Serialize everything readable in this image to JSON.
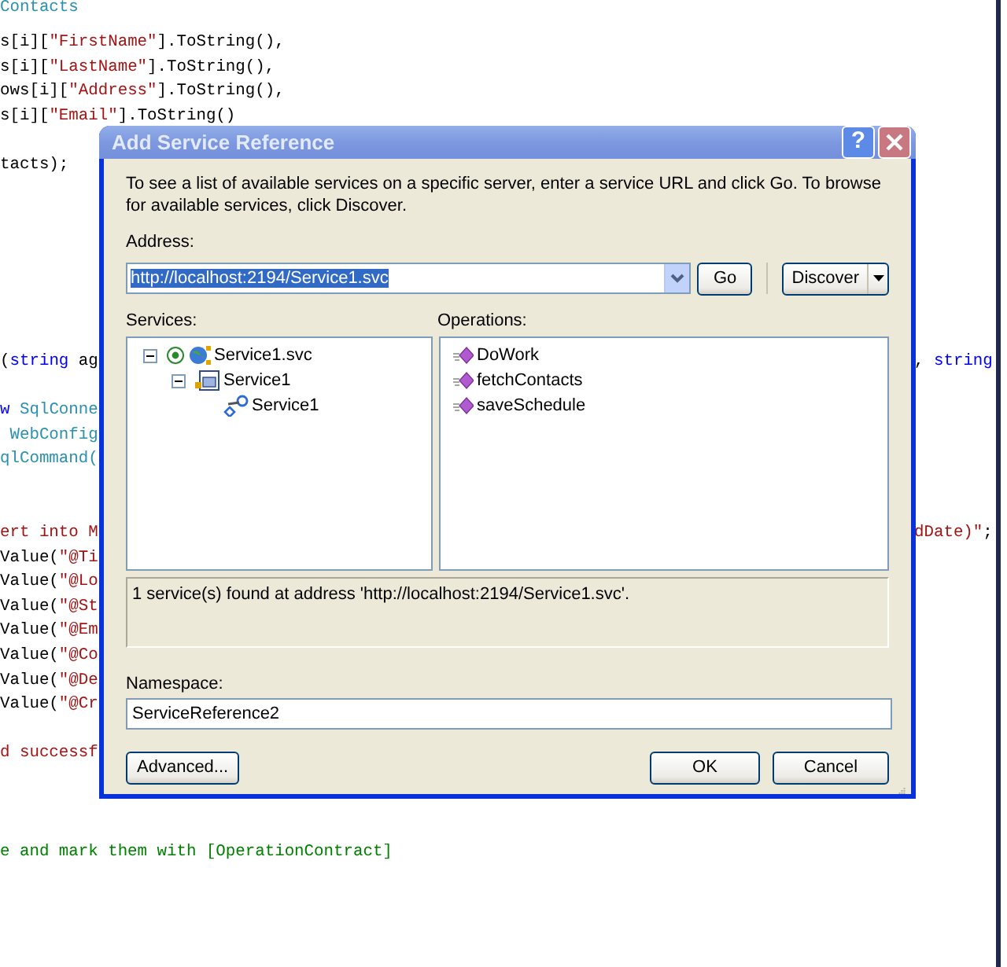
{
  "editor": {
    "code_lines": [
      {
        "left": [
          {
            "text": "Contacts",
            "kind": "type"
          }
        ]
      },
      {
        "left": [
          {
            "text": "s[i][",
            "kind": "plain"
          },
          {
            "text": "\"FirstName\"",
            "kind": "string"
          },
          {
            "text": "].ToString(),",
            "kind": "plain"
          }
        ]
      },
      {
        "left": [
          {
            "text": "s[i][",
            "kind": "plain"
          },
          {
            "text": "\"LastName\"",
            "kind": "string"
          },
          {
            "text": "].ToString(),",
            "kind": "plain"
          }
        ]
      },
      {
        "left": [
          {
            "text": "ows[i][",
            "kind": "plain"
          },
          {
            "text": "\"Address\"",
            "kind": "string"
          },
          {
            "text": "].ToString(),",
            "kind": "plain"
          }
        ]
      },
      {
        "left": [
          {
            "text": "s[i][",
            "kind": "plain"
          },
          {
            "text": "\"Email\"",
            "kind": "string"
          },
          {
            "text": "].ToString()",
            "kind": "plain"
          }
        ]
      },
      {
        "left": [
          {
            "text": "tacts);",
            "kind": "plain"
          }
        ]
      },
      {
        "left": [
          {
            "text": "(",
            "kind": "plain"
          },
          {
            "text": "string",
            "kind": "keyword"
          },
          {
            "text": " ag",
            "kind": "plain"
          }
        ],
        "right": [
          {
            "text": ", ",
            "kind": "plain"
          },
          {
            "text": "string",
            "kind": "keyword"
          }
        ]
      },
      {
        "left": [
          {
            "text": "w",
            "kind": "keyword"
          },
          {
            "text": " SqlConne",
            "kind": "type"
          }
        ]
      },
      {
        "left": [
          {
            "text": " WebConfig",
            "kind": "type"
          }
        ]
      },
      {
        "left": [
          {
            "text": "qlCommand(",
            "kind": "type"
          }
        ]
      },
      {
        "left": [
          {
            "text": "ert into M",
            "kind": "string"
          }
        ],
        "right": [
          {
            "text": "dDate)\"",
            "kind": "string"
          },
          {
            "text": ";",
            "kind": "plain"
          }
        ]
      },
      {
        "left": [
          {
            "text": "Value(",
            "kind": "plain"
          },
          {
            "text": "\"@Ti",
            "kind": "string"
          }
        ]
      },
      {
        "left": [
          {
            "text": "Value(",
            "kind": "plain"
          },
          {
            "text": "\"@Lo",
            "kind": "string"
          }
        ]
      },
      {
        "left": [
          {
            "text": "Value(",
            "kind": "plain"
          },
          {
            "text": "\"@St",
            "kind": "string"
          }
        ]
      },
      {
        "left": [
          {
            "text": "Value(",
            "kind": "plain"
          },
          {
            "text": "\"@Em",
            "kind": "string"
          }
        ]
      },
      {
        "left": [
          {
            "text": "Value(",
            "kind": "plain"
          },
          {
            "text": "\"@Co",
            "kind": "string"
          }
        ]
      },
      {
        "left": [
          {
            "text": "Value(",
            "kind": "plain"
          },
          {
            "text": "\"@De",
            "kind": "string"
          }
        ]
      },
      {
        "left": [
          {
            "text": "Value(",
            "kind": "plain"
          },
          {
            "text": "\"@Cr",
            "kind": "string"
          }
        ]
      },
      {
        "left": [
          {
            "text": "d successf",
            "kind": "string"
          }
        ]
      },
      {
        "left": [
          {
            "text": "e and mark them with [OperationContract]",
            "kind": "comment"
          }
        ]
      }
    ]
  },
  "dialog": {
    "title": "Add Service Reference",
    "help_button": "?",
    "description": "To see a list of available services on a specific server, enter a service URL and click Go. To browse for available services, click Discover.",
    "address_label": "Address:",
    "address": {
      "value": "http://localhost:2194/Service1.svc",
      "text_selected": true
    },
    "go_button": "Go",
    "discover_button": "Discover",
    "services_label": "Services:",
    "services": [
      {
        "label": "Service1.svc",
        "kind": "service",
        "expanded": true,
        "children": [
          {
            "label": "Service1",
            "kind": "contract",
            "expanded": true,
            "children": [
              {
                "label": "Service1",
                "kind": "endpoint"
              }
            ]
          }
        ]
      }
    ],
    "operations_label": "Operations:",
    "operations": [
      "DoWork",
      "fetchContacts",
      "saveSchedule"
    ],
    "status": "1 service(s) found at address 'http://localhost:2194/Service1.svc'.",
    "namespace_label": "Namespace:",
    "namespace": "ServiceReference2",
    "buttons": {
      "advanced": "Advanced...",
      "ok": "OK",
      "cancel": "Cancel"
    }
  }
}
